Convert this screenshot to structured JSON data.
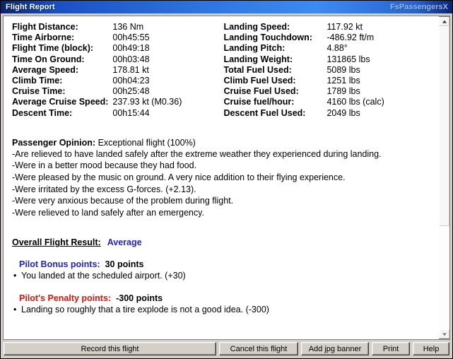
{
  "titlebar": {
    "title": "Flight Report",
    "app": "FsPassengersX"
  },
  "stats": {
    "left": [
      {
        "label": "Flight Distance:",
        "value": "136 Nm"
      },
      {
        "label": "Time Airborne:",
        "value": "00h45:55"
      },
      {
        "label": "Flight Time (block):",
        "value": "00h49:18"
      },
      {
        "label": "Time On Ground:",
        "value": "00h03:48"
      },
      {
        "label": "Average Speed:",
        "value": "178.81 kt"
      },
      {
        "label": "Climb Time:",
        "value": "00h04:23"
      },
      {
        "label": "Cruise Time:",
        "value": "00h25:48"
      },
      {
        "label": "Average Cruise Speed:",
        "value": "237.93 kt (M0.36)"
      },
      {
        "label": "Descent Time:",
        "value": "00h15:44"
      }
    ],
    "right": [
      {
        "label": "Landing Speed:",
        "value": "117.92 kt"
      },
      {
        "label": "Landing Touchdown:",
        "value": "-486.92 ft/m"
      },
      {
        "label": "Landing Pitch:",
        "value": "4.88°"
      },
      {
        "label": "Landing Weight:",
        "value": "131865 lbs"
      },
      {
        "label": "Total Fuel Used:",
        "value": "5089 lbs"
      },
      {
        "label": "Climb Fuel Used:",
        "value": "1251 lbs"
      },
      {
        "label": "Cruise Fuel Used:",
        "value": "1789 lbs"
      },
      {
        "label": "Cruise fuel/hour:",
        "value": "4160 lbs (calc)"
      },
      {
        "label": "Descent Fuel Used:",
        "value": "2049 lbs"
      }
    ]
  },
  "opinion": {
    "label": "Passenger Opinion:",
    "summary": "Exceptional flight (100%)",
    "lines": [
      "-Are relieved to have landed safely after the extreme weather they experienced during landing.",
      "-Were in a better mood because they had food.",
      "-Were pleased by the music on ground.  A very nice addition to their flying experience.",
      "-Were irritated by the excess G-forces. (+2.13).",
      "-Were very anxious because of the problem during flight.",
      "-Were relieved to land safely after an emergency."
    ]
  },
  "result": {
    "label": "Overall Flight Result:",
    "value": "Average",
    "bonus": {
      "label": "Pilot Bonus points:",
      "value": "30 points",
      "items": [
        "You landed at the scheduled airport. (+30)"
      ]
    },
    "penalty": {
      "label": "Pilot's Penalty points:",
      "value": "-300 points",
      "items": [
        "Landing so roughly that a tire explode is not a good idea. (-300)"
      ]
    }
  },
  "buttons": {
    "record": "Record this flight",
    "cancel": "Cancel this flight",
    "banner": "Add jpg banner",
    "print": "Print",
    "help": "Help"
  },
  "colors": {
    "title_bar_blue": "#1b4fc4",
    "accent_blue": "#2222cc",
    "penalty_red": "#dd1111",
    "app_label_blue": "#93b8ef"
  }
}
